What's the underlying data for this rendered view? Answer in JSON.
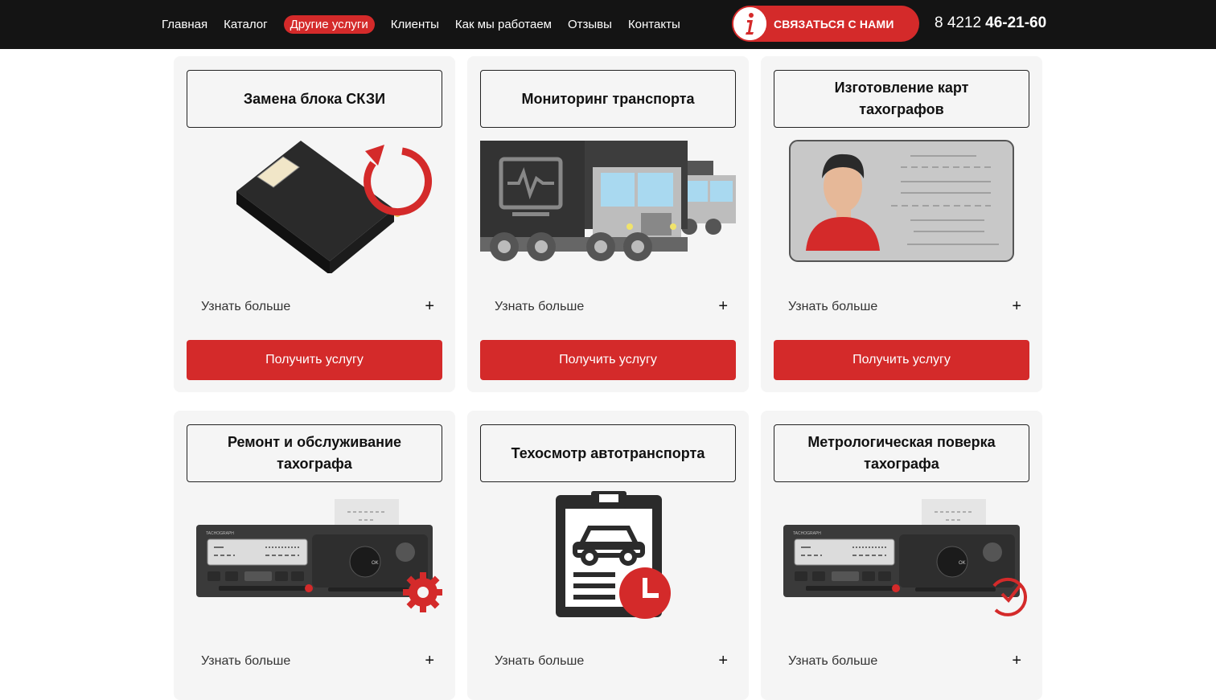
{
  "nav": {
    "items": [
      "Главная",
      "Каталог",
      "Другие услуги",
      "Клиенты",
      "Как мы работаем",
      "Отзывы",
      "Контакты"
    ],
    "active": "Другие услуги"
  },
  "contact": {
    "label": "СВЯЗАТЬСЯ С НАМИ",
    "icon": "info-icon"
  },
  "phone": {
    "code": "8 4212",
    "number": "46-21-60"
  },
  "colors": {
    "accent": "#d42a2a",
    "header_bg": "#141414",
    "card_bg": "#f5f5f5"
  },
  "cards": [
    {
      "title": "Замена блока СКЗИ",
      "more_label": "Узнать больше",
      "plus": "+",
      "button_label": "Получить услугу",
      "image": "skzi-block-replace-icon"
    },
    {
      "title": "Мониторинг транспорта",
      "more_label": "Узнать больше",
      "plus": "+",
      "button_label": "Получить услугу",
      "image": "transport-monitoring-trucks-icon"
    },
    {
      "title": "Изготовление карт тахографов",
      "more_label": "Узнать больше",
      "plus": "+",
      "button_label": "Получить услугу",
      "image": "driver-card-icon"
    },
    {
      "title": "Ремонт и обслуживание тахографа",
      "more_label": "Узнать больше",
      "plus": "+",
      "image": "tachograph-gear-icon"
    },
    {
      "title": "Техосмотр автотранспорта",
      "more_label": "Узнать больше",
      "plus": "+",
      "image": "inspection-clipboard-icon"
    },
    {
      "title": "Метрологическая поверка тахографа",
      "more_label": "Узнать больше",
      "plus": "+",
      "image": "tachograph-check-icon"
    }
  ]
}
